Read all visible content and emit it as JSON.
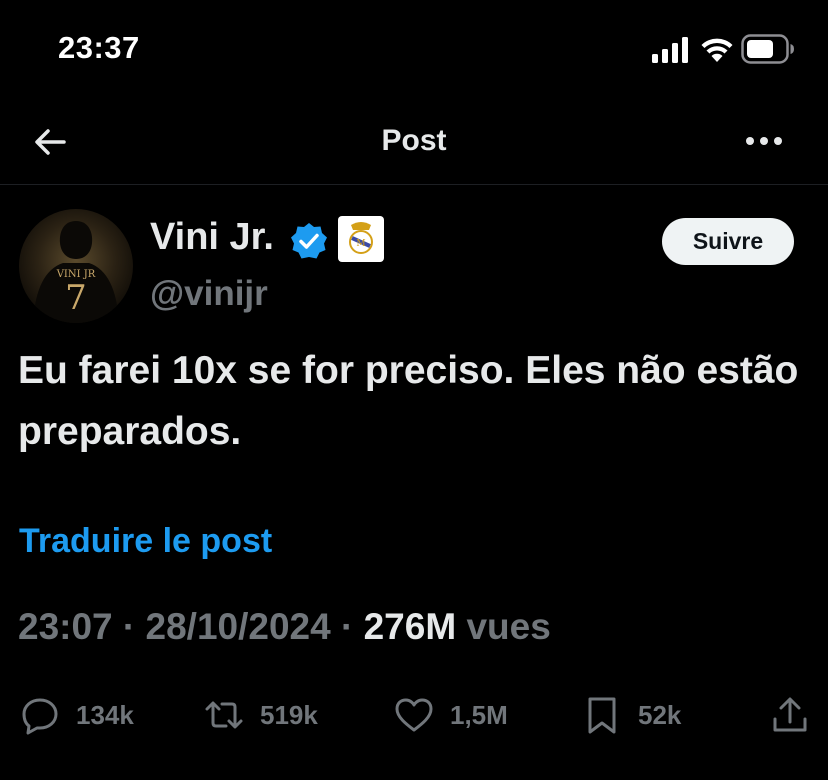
{
  "status_bar": {
    "time": "23:37"
  },
  "header": {
    "title": "Post"
  },
  "author": {
    "name": "Vini Jr.",
    "handle": "@vinijr",
    "avatar_jersey_text": "VINI JR",
    "avatar_jersey_number": "7",
    "follow_label": "Suivre"
  },
  "tweet": {
    "text": "Eu farei 10x se for preciso. Eles não estão preparados.",
    "translate_label": "Traduire le post",
    "time": "23:07",
    "date": "28/10/2024",
    "views_count": "276M",
    "views_label": "vues"
  },
  "actions": {
    "replies": "134k",
    "reposts": "519k",
    "likes": "1,5M",
    "bookmarks": "52k"
  },
  "colors": {
    "background": "#000000",
    "text": "#e7e9ea",
    "muted": "#71767b",
    "link": "#1d9bf0",
    "verified": "#1d9bf0"
  }
}
